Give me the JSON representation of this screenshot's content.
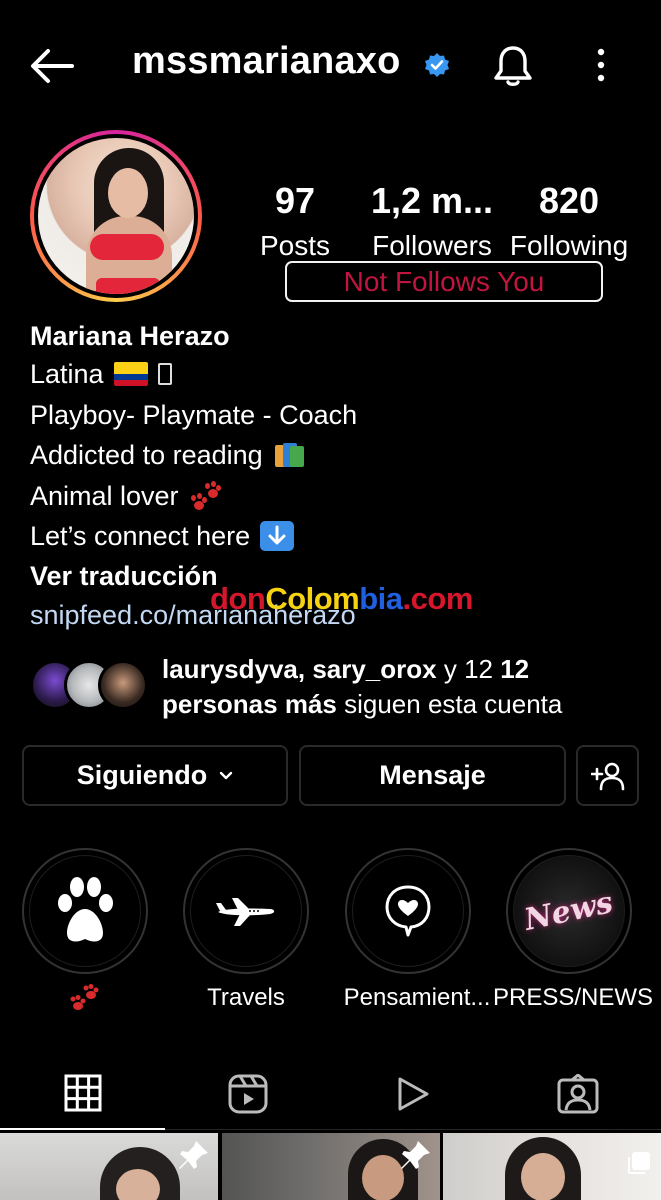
{
  "header": {
    "username": "mssmarianaxo",
    "icons": [
      "back-arrow-icon",
      "verified-badge-icon",
      "bell-icon",
      "more-vertical-icon"
    ]
  },
  "stats": {
    "posts": {
      "value": "97",
      "label": "Posts"
    },
    "followers": {
      "value": "1,2 m...",
      "label": "Followers"
    },
    "following": {
      "value": "820",
      "label": "Following"
    }
  },
  "follow_status": "Not Follows You",
  "bio": {
    "name": "Mariana Herazo",
    "line1": "Latina",
    "line2": "Playboy- Playmate - Coach",
    "line3": "Addicted to reading",
    "line4": "Animal lover",
    "line5": "Let’s connect here",
    "translate": "Ver traducción",
    "link": "snipfeed.co/marianaherazo"
  },
  "watermark": {
    "part1": "don",
    "part2": "Colom",
    "part3": "bia",
    "part4": ".com"
  },
  "mutual": {
    "names": "laurysdyva, sary_orox",
    "joiner": " y 12 ",
    "count_text": "personas más",
    "suffix": " siguen esta cuenta"
  },
  "actions": {
    "following_label": "Siguiendo",
    "message_label": "Mensaje"
  },
  "highlights": [
    {
      "label": "",
      "icon": "paw-icon"
    },
    {
      "label": "Travels",
      "icon": "airplane-icon"
    },
    {
      "label": "Pensamient...",
      "icon": "heart-bubble-icon"
    },
    {
      "label": "PRESS/NEWS C",
      "icon": "news-icon",
      "badge": "News"
    }
  ],
  "tabs": [
    "grid-icon",
    "reels-icon",
    "video-play-icon",
    "tagged-icon"
  ],
  "colors": {
    "background": "#000000",
    "link": "#c3d9f3",
    "not_follows": "#c0153f",
    "verified": "#3897f0",
    "watermark_red": "#d6162b",
    "watermark_yellow": "#f5d313",
    "watermark_blue": "#1f5fe0"
  }
}
